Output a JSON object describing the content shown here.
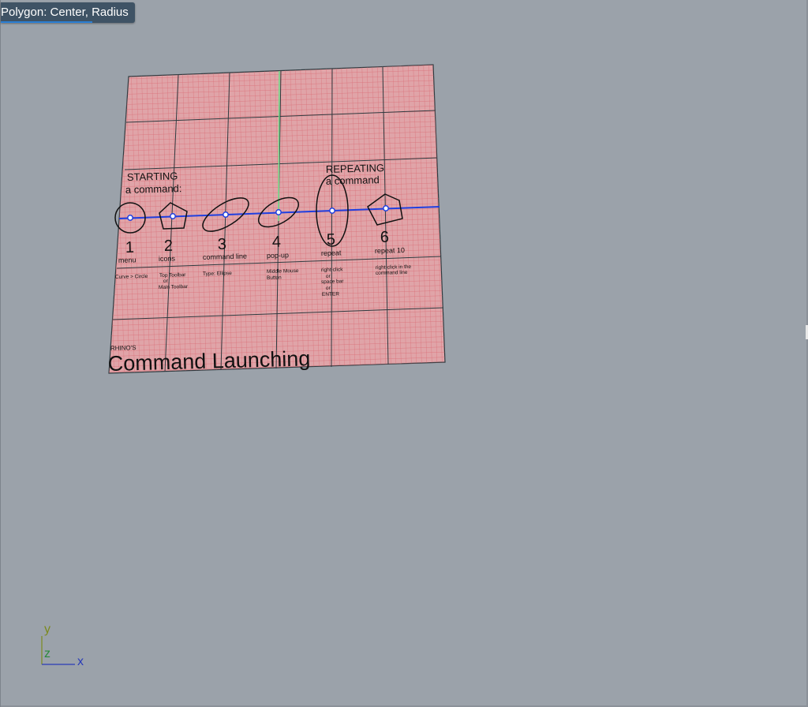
{
  "tooltip": {
    "text": "Polygon: Center, Radius"
  },
  "colors": {
    "viewport_bg": "#9ba2aa",
    "plane_fill": "#e0a4a8",
    "grid_minor": "#d9616b",
    "grid_major": "#2f3a3f",
    "construction_line": "#1f3fe0",
    "green_axis": "#6fe08a",
    "axis_x": "#2a3cb8",
    "axis_y": "#7c8a1e",
    "axis_z": "#2a8a3a"
  },
  "drawing": {
    "starting_heading_1": "STARTING",
    "starting_heading_2": "a command:",
    "repeating_heading_1": "REPEATING",
    "repeating_heading_2": "a command",
    "numbers": [
      "1",
      "2",
      "3",
      "4",
      "5",
      "6"
    ],
    "methods": [
      "menu",
      "icons",
      "command line",
      "pop-up",
      "repeat",
      "repeat 10"
    ],
    "notes": {
      "n1": [
        "Curve > Circle"
      ],
      "n2": [
        "Top Toolbar",
        "or",
        "Main Toolbar"
      ],
      "n3": [
        "Type: Ellipse"
      ],
      "n4": [
        "Middle Mouse",
        "Button"
      ],
      "n5": [
        "right-click",
        "or",
        "space bar",
        "or",
        "ENTER"
      ],
      "n6": [
        "right-click in the",
        "command line"
      ]
    },
    "footer_small": "RHINO'S",
    "footer_title": "Command Launching"
  },
  "axes": {
    "x": "x",
    "y": "y",
    "z": "z"
  }
}
